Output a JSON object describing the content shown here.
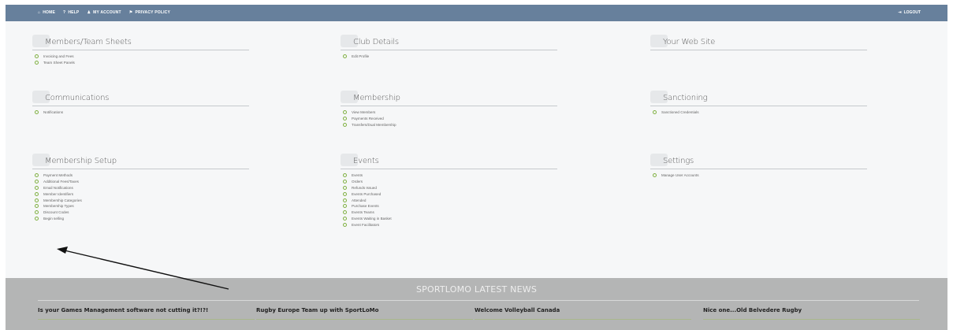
{
  "topbar": {
    "items": [
      {
        "icon": "home-icon",
        "glyph": "⌂",
        "label": "HOME"
      },
      {
        "icon": "help-icon",
        "glyph": "?",
        "label": "HELP"
      },
      {
        "icon": "user-icon",
        "glyph": "♟",
        "label": "MY ACCOUNT"
      },
      {
        "icon": "lock-icon",
        "glyph": "⚑",
        "label": "PRIVACY POLICY"
      }
    ],
    "logout": {
      "glyph": "⇥",
      "label": "LOGOUT"
    }
  },
  "sections": [
    {
      "title": "Members/Team Sheets",
      "items": [
        "Invoicing and Fees",
        "Team Sheet Panels"
      ]
    },
    {
      "title": "Club Details",
      "items": [
        "Edit Profile"
      ]
    },
    {
      "title": "Your Web Site",
      "items": []
    },
    {
      "title": "Communications",
      "items": [
        "Notifications"
      ]
    },
    {
      "title": "Membership",
      "items": [
        "View Members",
        "Payments Received",
        "Transfers/Dual Membership"
      ]
    },
    {
      "title": "Sanctioning",
      "items": [
        "Sanctioned Credentials"
      ]
    },
    {
      "title": "Membership Setup",
      "items": [
        "Payment Methods",
        "Additional Fees/Taxes",
        "Email Notifications",
        "Member Identifiers",
        "Membership Categories",
        "Membership Types",
        "Discount Codes",
        "Begin selling"
      ]
    },
    {
      "title": "Events",
      "items": [
        "Events",
        "Orders",
        "Refunds Issued",
        "Events Purchased",
        "Attended",
        "Purchase Events",
        "Events Teams",
        "Events Waiting in Basket",
        "Event Facilitators"
      ]
    },
    {
      "title": "Settings",
      "items": [
        "Manage User Accounts"
      ]
    }
  ],
  "news": {
    "title": "SPORTLOMO LATEST NEWS",
    "items": [
      "Is your Games Management software not cutting it?!?!",
      "Rugby Europe Team up with SportLoMo",
      "Welcome Volleyball Canada",
      "Nice one...Old Belvedere Rugby"
    ]
  }
}
